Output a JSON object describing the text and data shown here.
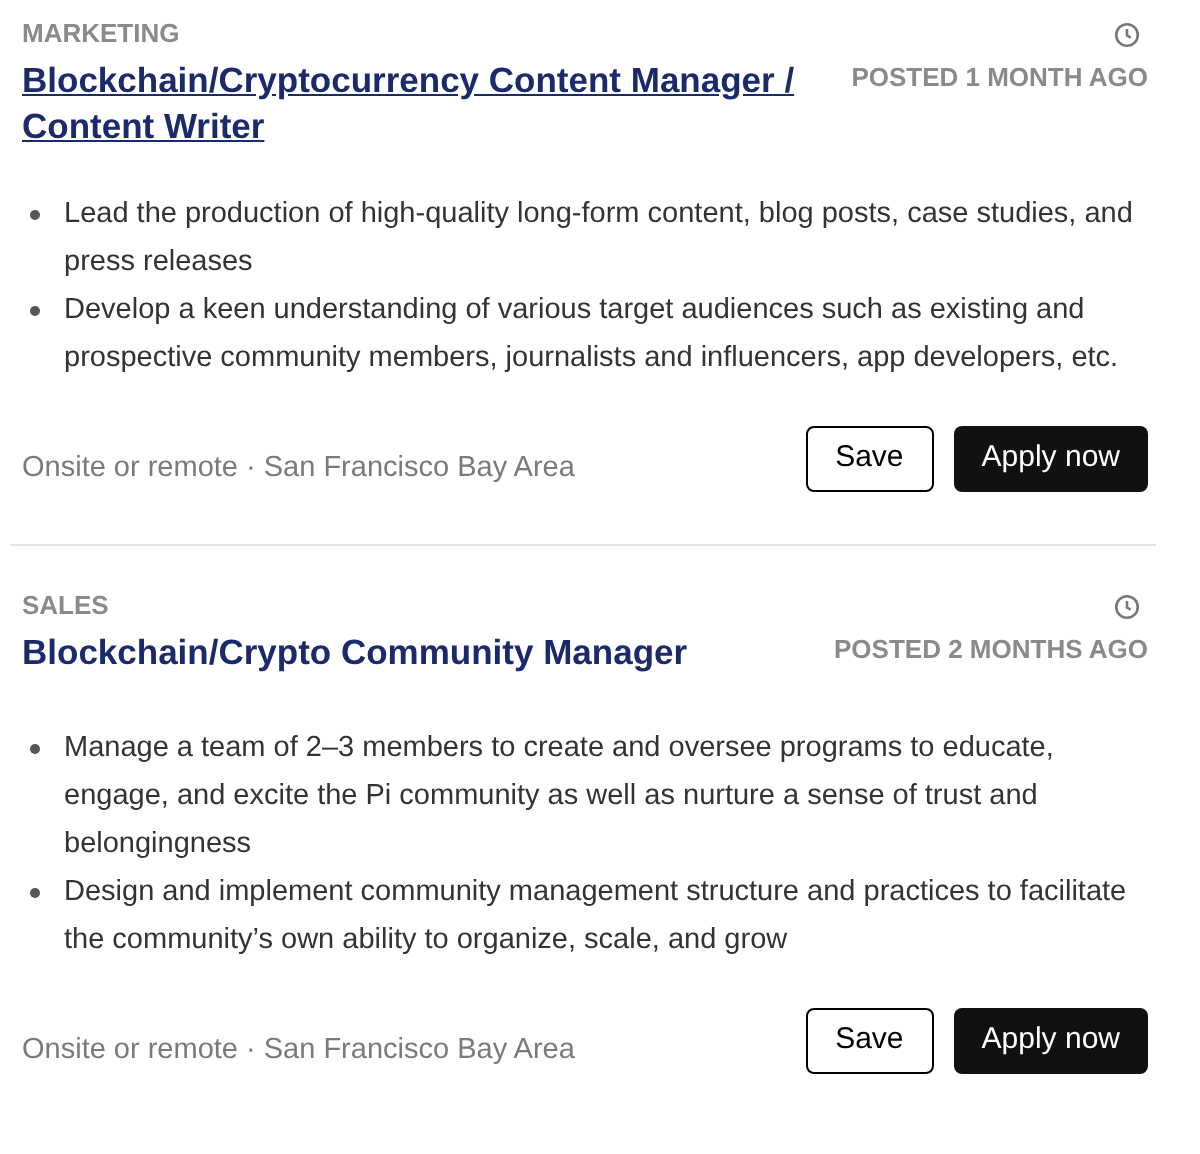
{
  "jobs": [
    {
      "category": "MARKETING",
      "title": "Blockchain/Cryptocurrency Content Manager / Content Writer",
      "underlined": true,
      "posted": "POSTED 1 MONTH AGO",
      "bullets": [
        "Lead the production of high-quality long-form content, blog posts, case studies, and press releases",
        "Develop a keen understanding of various target audiences such as existing and prospective community members, journalists and influencers, app developers, etc."
      ],
      "location": "Onsite or remote · San Francisco Bay Area",
      "buttons": [
        "Save",
        "Apply now"
      ]
    },
    {
      "category": "SALES",
      "title": "Blockchain/Crypto Community Manager",
      "underlined": false,
      "posted": "POSTED 2 MONTHS AGO",
      "bullets": [
        "Manage a team of 2–3 members to create and oversee programs to educate, engage, and excite the Pi community as well as nurture a sense of trust and belongingness",
        "Design and implement community management structure and practices to facilitate the community’s own ability to organize, scale, and grow"
      ],
      "location": "Onsite or remote · San Francisco Bay Area",
      "buttons": [
        "Save",
        "Apply now"
      ]
    }
  ]
}
